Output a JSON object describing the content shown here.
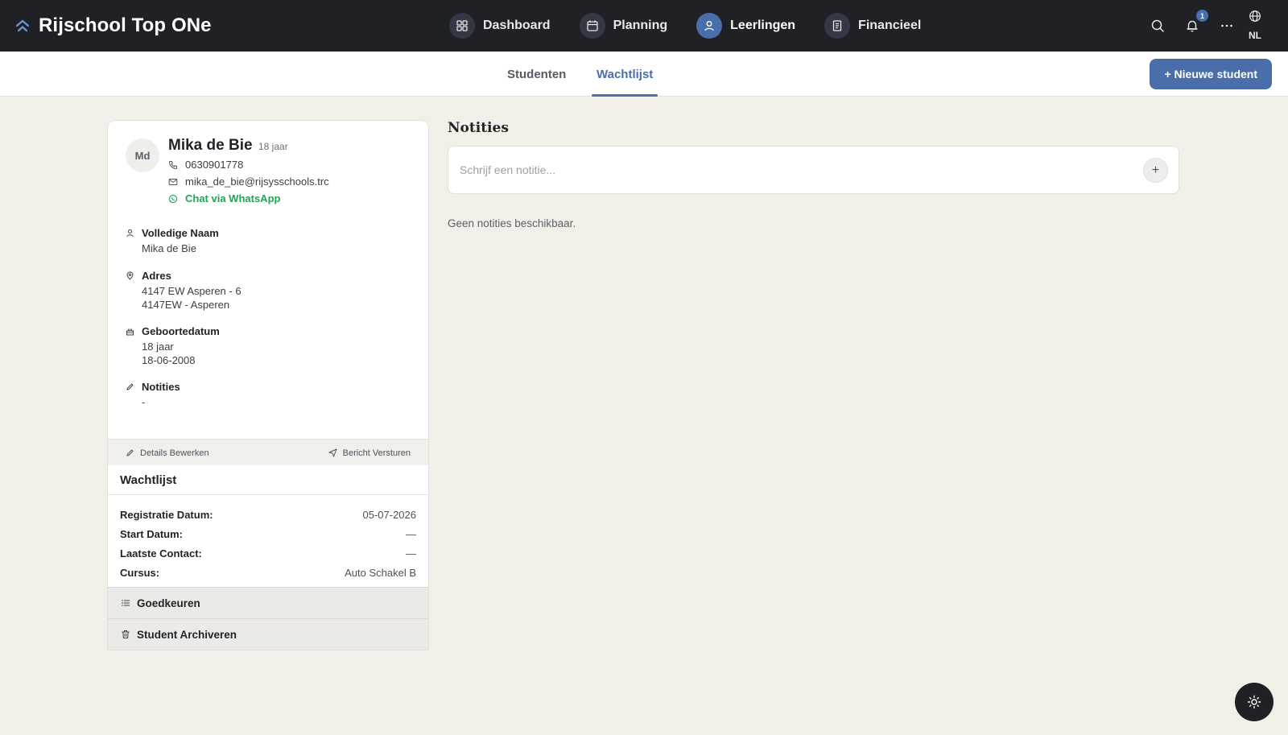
{
  "app": {
    "title": "Rijschool Top ONe"
  },
  "nav": {
    "items": [
      {
        "label": "Dashboard",
        "icon": "grid-icon",
        "active": false
      },
      {
        "label": "Planning",
        "icon": "calendar-icon",
        "active": false
      },
      {
        "label": "Leerlingen",
        "icon": "user-icon",
        "active": true
      },
      {
        "label": "Financieel",
        "icon": "receipt-icon",
        "active": false
      }
    ]
  },
  "topbar": {
    "notification_count": "1",
    "language": "NL"
  },
  "tabs": {
    "students": "Studenten",
    "waitlist": "Wachtlijst",
    "active": "Wachtlijst"
  },
  "actions": {
    "new_student": "+ Nieuwe student"
  },
  "student": {
    "initials": "Md",
    "name": "Mika de Bie",
    "age": "18 jaar",
    "phone": "0630901778",
    "email": "mika_de_bie@rijsysschools.trc",
    "whatsapp": "Chat via WhatsApp",
    "details": {
      "full_name_label": "Volledige Naam",
      "full_name": "Mika de Bie",
      "address_label": "Adres",
      "address_line1": "4147 EW Asperen - 6",
      "address_line2": "4147EW - Asperen",
      "birthdate_label": "Geboortedatum",
      "birthdate_age": "18 jaar",
      "birthdate": "18-06-2008",
      "notes_label": "Notities",
      "notes": "-"
    },
    "footer": {
      "edit": "Details Bewerken",
      "message": "Bericht Versturen"
    }
  },
  "waitlist": {
    "title": "Wachtlijst",
    "rows": [
      {
        "label": "Registratie Datum:",
        "value": "05-07-2026"
      },
      {
        "label": "Start Datum:",
        "value": "—"
      },
      {
        "label": "Laatste Contact:",
        "value": "—"
      },
      {
        "label": "Cursus:",
        "value": "Auto Schakel B"
      }
    ],
    "approve": "Goedkeuren",
    "archive": "Student Archiveren"
  },
  "notes": {
    "title": "Notities",
    "placeholder": "Schrijf een notitie...",
    "add_symbol": "+",
    "empty": "Geen notities beschikbaar."
  },
  "colors": {
    "topbar": "#1f2124",
    "accent": "#4a6ea9",
    "whatsapp": "#22a355",
    "background": "#f2efe9"
  }
}
